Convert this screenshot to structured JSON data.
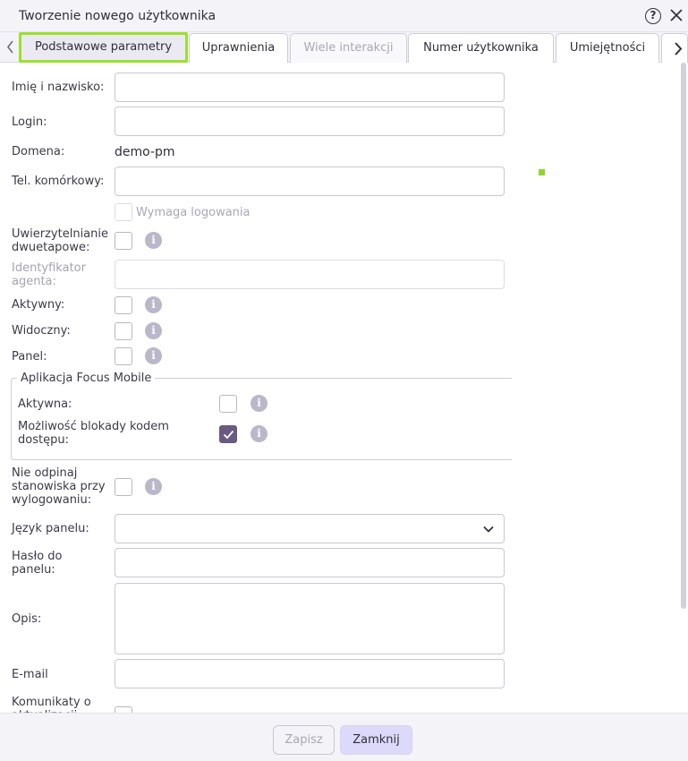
{
  "window": {
    "title": "Tworzenie nowego użytkownika",
    "help_icon": "question-circle-icon",
    "close_icon": "close-icon",
    "help_glyph": "?"
  },
  "tabs": [
    {
      "label": "Podstawowe parametry",
      "state": "active"
    },
    {
      "label": "Uprawnienia",
      "state": "normal"
    },
    {
      "label": "Wiele interakcji",
      "state": "disabled"
    },
    {
      "label": "Numer użytkownika",
      "state": "normal"
    },
    {
      "label": "Umiejętności",
      "state": "normal"
    }
  ],
  "form": {
    "name_label": "Imię i nazwisko:",
    "name_value": "",
    "login_label": "Login:",
    "login_value": "",
    "domain_label": "Domena:",
    "domain_value": "demo-pm",
    "mobile_label": "Tel. komórkowy:",
    "mobile_value": "",
    "requires_login_label": "Wymaga logowania",
    "requires_login_checked": false,
    "two_factor_label": "Uwierzytelnianie dwuetapowe:",
    "two_factor_checked": false,
    "agent_id_label": "Identyfikator agenta:",
    "agent_id_value": "",
    "active_label": "Aktywny:",
    "active_checked": false,
    "visible_label": "Widoczny:",
    "visible_checked": false,
    "panel_label": "Panel:",
    "panel_checked": false,
    "focus_mobile": {
      "legend": "Aplikacja Focus Mobile",
      "active_label": "Aktywna:",
      "active_checked": false,
      "lock_label": "Możliwość blokady kodem dostępu:",
      "lock_checked": true
    },
    "keep_station_label": "Nie odpinaj stanowiska przy wylogowaniu:",
    "keep_station_checked": false,
    "panel_language_label": "Język panelu:",
    "panel_language_value": "",
    "panel_password_label": "Hasło do panelu:",
    "panel_password_value": "",
    "description_label": "Opis:",
    "description_value": "",
    "email_label": "E-mail",
    "email_value": "",
    "notifications_label": "Komunikaty o aktualizacji"
  },
  "info_glyph": "i",
  "footer": {
    "save_label": "Zapisz",
    "close_label": "Zamknij"
  },
  "colors": {
    "accent": "#6a5a82",
    "highlight": "#9be02b",
    "primary_button": "#dcd9fa"
  }
}
